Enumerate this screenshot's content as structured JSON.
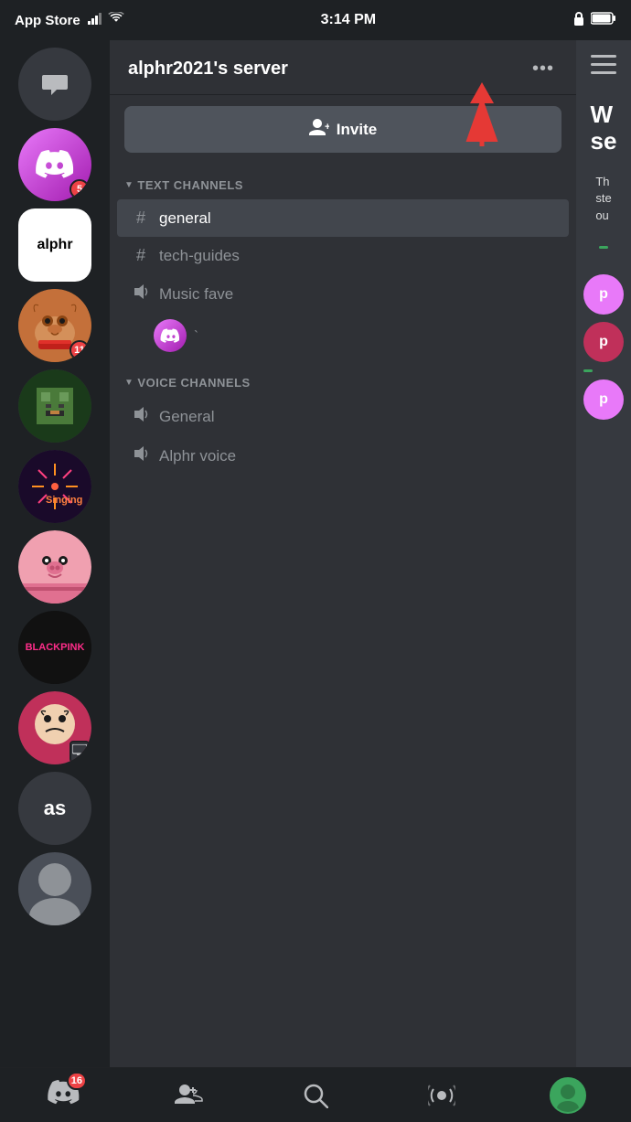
{
  "statusBar": {
    "carrier": "App Store",
    "time": "3:14 PM",
    "batteryIcon": "🔋"
  },
  "serverList": {
    "items": [
      {
        "id": "dm",
        "type": "dm",
        "icon": "💬",
        "color": "#36393f",
        "badge": null
      },
      {
        "id": "discord",
        "type": "discord",
        "icon": "🎮",
        "color": "#e879f9",
        "badge": "5"
      },
      {
        "id": "alphr",
        "type": "alphr",
        "label": "alphr",
        "color": "#fff",
        "badge": null
      },
      {
        "id": "dog",
        "type": "image",
        "color": "#c4703a",
        "badge": "11"
      },
      {
        "id": "minecraft",
        "type": "image",
        "color": "#3a7a3a",
        "badge": null
      },
      {
        "id": "singing",
        "type": "image",
        "color": "#1a1a2e",
        "badge": null
      },
      {
        "id": "game",
        "type": "image",
        "color": "#c05080",
        "badge": null
      },
      {
        "id": "blackpink",
        "type": "image",
        "color": "#111",
        "badge": null
      },
      {
        "id": "crying",
        "type": "image",
        "color": "#c0305a",
        "badge": null
      },
      {
        "id": "as",
        "type": "text",
        "label": "as",
        "color": "#36393f",
        "badge": null
      },
      {
        "id": "partial",
        "type": "partial",
        "color": "#36393f",
        "badge": null
      }
    ]
  },
  "channelPanel": {
    "serverName": "alphr2021's server",
    "moreOptionsLabel": "•••",
    "inviteLabel": "Invite",
    "inviteIcon": "👤+",
    "textChannelsHeader": "TEXT CHANNELS",
    "channels": [
      {
        "id": "general",
        "type": "text",
        "name": "general",
        "active": true
      },
      {
        "id": "tech-guides",
        "type": "text",
        "name": "tech-guides",
        "active": false
      },
      {
        "id": "music-fave",
        "type": "voice",
        "name": "Music fave",
        "active": false
      }
    ],
    "botAvatar": "discord",
    "voiceChannelsHeader": "VOICE CHANNELS",
    "voiceChannels": [
      {
        "id": "general-voice",
        "type": "voice",
        "name": "General"
      },
      {
        "id": "alphr-voice",
        "type": "voice",
        "name": "Alphr voice"
      }
    ]
  },
  "rightPanel": {
    "partialText": "W se",
    "description": "Th ste ou",
    "avatars": [
      {
        "color": "#e879f9",
        "label": "p"
      },
      {
        "color": "#c0305a",
        "label": "p"
      },
      {
        "color": "#e879f9",
        "label": "p"
      }
    ],
    "statusDots": [
      "#3ba55d",
      "#3ba55d"
    ]
  },
  "bottomNav": {
    "items": [
      {
        "id": "home",
        "icon": "🎮",
        "badge": "16",
        "active": false
      },
      {
        "id": "friends",
        "icon": "👤",
        "badge": null,
        "active": false
      },
      {
        "id": "search",
        "icon": "🔍",
        "badge": null,
        "active": false
      },
      {
        "id": "activity",
        "icon": "📡",
        "badge": null,
        "active": false
      },
      {
        "id": "profile",
        "icon": "👤",
        "badge": null,
        "active": true,
        "color": "#3ba55d"
      }
    ]
  },
  "redArrow": {
    "visible": true
  }
}
